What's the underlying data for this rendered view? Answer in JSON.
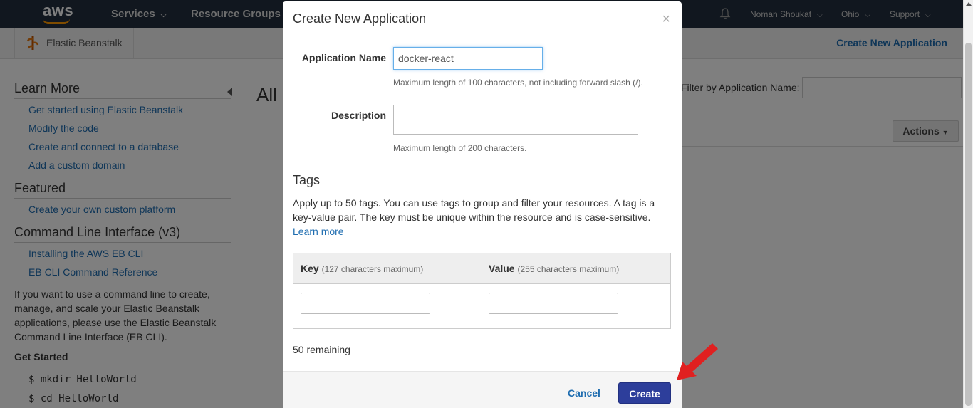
{
  "topnav": {
    "logo": "aws",
    "services": "Services",
    "resource_groups": "Resource Groups",
    "user": "Noman Shoukat",
    "region": "Ohio",
    "support": "Support",
    "icons": [
      "bell-icon",
      "chevron-down-icon"
    ]
  },
  "subbar": {
    "service_name": "Elastic Beanstalk",
    "create_link": "Create New Application"
  },
  "sidebar": {
    "learn_more": {
      "heading": "Learn More",
      "links": [
        "Get started using Elastic Beanstalk",
        "Modify the code",
        "Create and connect to a database",
        "Add a custom domain"
      ]
    },
    "featured": {
      "heading": "Featured",
      "links": [
        "Create your own custom platform"
      ]
    },
    "cli": {
      "heading": "Command Line Interface (v3)",
      "links": [
        "Installing the AWS EB CLI",
        "EB CLI Command Reference"
      ],
      "paragraph": "If you want to use a command line to create, manage, and scale your Elastic Beanstalk applications, please use the Elastic Beanstalk Command Line Interface (EB CLI)."
    },
    "get_started": {
      "heading": "Get Started",
      "commands": [
        "$ mkdir HelloWorld",
        "$ cd HelloWorld"
      ]
    }
  },
  "background": {
    "title_partial": "All",
    "filter_label": "Filter by Application Name:",
    "actions_label": "Actions"
  },
  "modal": {
    "title": "Create New Application",
    "close": "×",
    "app_name_label": "Application Name",
    "app_name_value": "docker-react",
    "app_name_help": "Maximum length of 100 characters, not including forward slash (/).",
    "description_label": "Description",
    "description_value": "",
    "description_help": "Maximum length of 200 characters.",
    "tags_heading": "Tags",
    "tags_desc": "Apply up to 50 tags. You can use tags to group and filter your resources. A tag is a key-value pair. The key must be unique within the resource and is case-sensitive.",
    "tags_learn_more": "Learn more",
    "key_header": "Key",
    "key_hint": "(127 characters maximum)",
    "value_header": "Value",
    "value_hint": "(255 characters maximum)",
    "remaining": "50 remaining",
    "cancel_label": "Cancel",
    "create_label": "Create"
  },
  "colors": {
    "nav_bg": "#232f3e",
    "link": "#1f6db0",
    "primary_button": "#2d3e9b",
    "annotation_arrow": "#e02020"
  }
}
